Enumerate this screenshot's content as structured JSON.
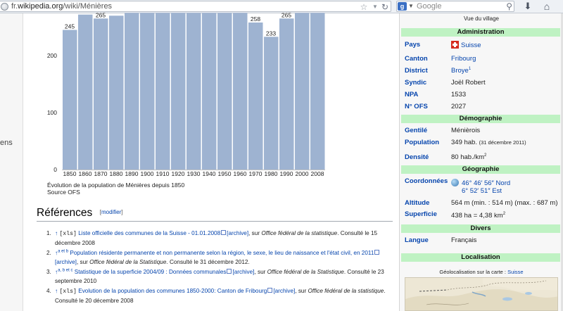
{
  "browser": {
    "url_prefix": "fr.",
    "url_domain": "wikipedia.org",
    "url_path": "/wiki/Ménières",
    "search_placeholder": "Google",
    "search_engine_badge": "g",
    "icons": [
      "globe-icon",
      "star-icon",
      "dropdown-icon",
      "reload-icon",
      "search-icon",
      "download-icon",
      "home-icon"
    ]
  },
  "gutter": {
    "text": "ens"
  },
  "chart_data": {
    "type": "bar",
    "categories": [
      "1850",
      "1860",
      "1870",
      "1880",
      "1890",
      "1900",
      "1910",
      "1920",
      "1930",
      "1940",
      "1950",
      "1960",
      "1970",
      "1980",
      "1990",
      "2000",
      "2008"
    ],
    "values": [
      245,
      272,
      265,
      270,
      290,
      295,
      300,
      300,
      300,
      300,
      300,
      290,
      258,
      233,
      265,
      290,
      349
    ],
    "visible_value_labels": [
      {
        "category": "1850",
        "text": "245"
      },
      {
        "category": "1870",
        "text": "265"
      },
      {
        "category": "1970",
        "text": "258"
      },
      {
        "category": "1980",
        "text": "233"
      },
      {
        "category": "1990",
        "text": "265"
      }
    ],
    "ytick_labels": [
      "0",
      "100",
      "200"
    ],
    "ylim_visible": [
      0,
      275
    ],
    "caption_line1": "Évolution de la population de Ménières depuis 1850",
    "caption_line2": "Source OFS",
    "bar_color": "#9eb3d1"
  },
  "references": {
    "title": "Références",
    "edit_open": "[",
    "edit_label": "modifier",
    "edit_close": "]",
    "items": [
      {
        "num": "1.",
        "arrow": "↑",
        "prefix_sup": "",
        "tag": "[xls]",
        "link": "Liste officielle des communes de la Suisse - 01.01.2008",
        "archive": "[archive]",
        "sur": ", sur ",
        "source": "Office fédéral de la statistique",
        "consult": ". Consulté le 15 décembre 2008"
      },
      {
        "num": "2.",
        "arrow": "↑",
        "prefix_sup": "a et b",
        "tag": "",
        "link": "Population résidente permanente et non permanente selon la région, le sexe, le lieu de naissance et l'état civil, en 2011",
        "archive": "[archive]",
        "sur": ", sur ",
        "source": "Office fédéral de la Statistique",
        "consult": ". Consulté le 31 décembre 2012."
      },
      {
        "num": "3.",
        "arrow": "↑",
        "prefix_sup": "a, b et c",
        "tag": "",
        "link": "Statistique de la superficie 2004/09 : Données communales",
        "archive": "[archive]",
        "sur": ", sur ",
        "source": "Office fédéral de la Statistique",
        "consult": ". Consulté le 23 septembre 2010"
      },
      {
        "num": "4.",
        "arrow": "↑",
        "prefix_sup": "",
        "tag": "[xls]",
        "link": "Evolution de la population des communes 1850-2000: Canton de Fribourg",
        "archive": "[archive]",
        "sur": ", sur ",
        "source": "Office fédéral de la statistique",
        "consult": ". Consulté le 20 décembre 2008"
      }
    ]
  },
  "infobox": {
    "caption": "Vue du village",
    "headers": {
      "administration": "Administration",
      "demographie": "Démographie",
      "geographie": "Géographie",
      "divers": "Divers",
      "localisation": "Localisation"
    },
    "pays_label": "Pays",
    "pays_value": "Suisse",
    "canton_label": "Canton",
    "canton_value": "Fribourg",
    "district_label": "District",
    "district_value": "Broye",
    "district_sup": "1",
    "syndic_label": "Syndic",
    "syndic_value": "Joël Robert",
    "npa_label": "NPA",
    "npa_value": "1533",
    "ofs_label": "N° OFS",
    "ofs_value": "2027",
    "gentile_label": "Gentilé",
    "gentile_value": "Ménièrois",
    "population_label": "Population",
    "population_value": "349 hab.",
    "population_date": "(31 décembre 2011)",
    "densite_label": "Densité",
    "densite_value": "80 hab./km",
    "densite_sup": "2",
    "coord_label": "Coordonnées",
    "coord_lat": "46° 46′ 56″ Nord",
    "coord_lon": "6° 52′ 51″ Est",
    "altitude_label": "Altitude",
    "altitude_value": "564 m (min. : 514 m) (max. : 687 m)",
    "superficie_label": "Superficie",
    "superficie_value": "438 ha = 4,38 km",
    "superficie_sup": "2",
    "langue_label": "Langue",
    "langue_value": "Français",
    "geoloc_text": "Géolocalisation sur la carte : ",
    "geoloc_link": "Suisse"
  }
}
